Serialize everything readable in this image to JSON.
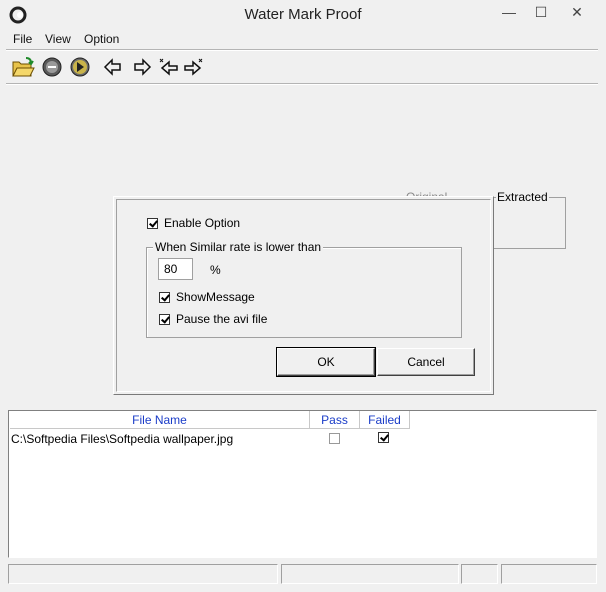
{
  "window": {
    "title": "Water Mark Proof",
    "minimize_glyph": "—",
    "maximize_glyph": "☐",
    "close_glyph": "✕"
  },
  "menu": {
    "items": [
      {
        "label": "File"
      },
      {
        "label": "View"
      },
      {
        "label": "Option"
      }
    ]
  },
  "toolbar": {
    "icons": [
      "open-folder-icon",
      "stop-icon",
      "play-icon",
      "arrow-left-icon",
      "arrow-right-icon",
      "step-back-icon",
      "step-forward-icon"
    ]
  },
  "panels": {
    "original_label": "Original",
    "extracted_label": "Extracted"
  },
  "dialog": {
    "enable_option_label": "Enable Option",
    "enable_option_checked": true,
    "group_label": "When Similar rate is lower than",
    "rate_value": "80",
    "rate_unit": "%",
    "show_message_label": "ShowMessage",
    "show_message_checked": true,
    "pause_avi_label": "Pause the avi file",
    "pause_avi_checked": true,
    "ok_label": "OK",
    "cancel_label": "Cancel"
  },
  "list": {
    "columns": [
      "File Name",
      "Pass",
      "Failed"
    ],
    "rows": [
      {
        "file": "C:\\Softpedia Files\\Softpedia wallpaper.jpg",
        "pass": false,
        "failed": true
      }
    ]
  },
  "colors": {
    "header_text": "#1a3cc8",
    "window_bg": "#f0f0f0"
  }
}
